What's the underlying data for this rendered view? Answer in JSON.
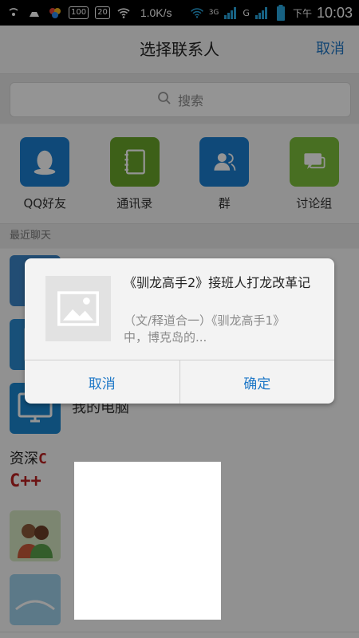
{
  "status_bar": {
    "speed": "1.0K/s",
    "ampm": "下午",
    "time": "10:03",
    "badge_100": "100",
    "badge_20": "20",
    "net_3g": "3G",
    "net_g": "G"
  },
  "header": {
    "title": "选择联系人",
    "cancel": "取消"
  },
  "search": {
    "placeholder": "搜索"
  },
  "categories": [
    {
      "label": "QQ好友",
      "color": "#1b7fd0"
    },
    {
      "label": "通讯录",
      "color": "#6aa62a"
    },
    {
      "label": "群",
      "color": "#1b7fd0"
    },
    {
      "label": "讨论组",
      "color": "#7cbf3c"
    }
  ],
  "section": {
    "recent": "最近聊天"
  },
  "recent": [
    {
      "name": ""
    },
    {
      "name": ""
    },
    {
      "name": "我的电脑"
    },
    {
      "avatar_text_1": "资深",
      "avatar_text_2": "C",
      "avatar_text_3": "C++"
    },
    {
      "name": ""
    },
    {
      "name": ""
    }
  ],
  "dialog": {
    "title": "《驯龙高手2》接班人打龙改革记",
    "description": "（文/释道合一）《驯龙高手1》中，博克岛的...",
    "cancel": "取消",
    "confirm": "确定"
  }
}
